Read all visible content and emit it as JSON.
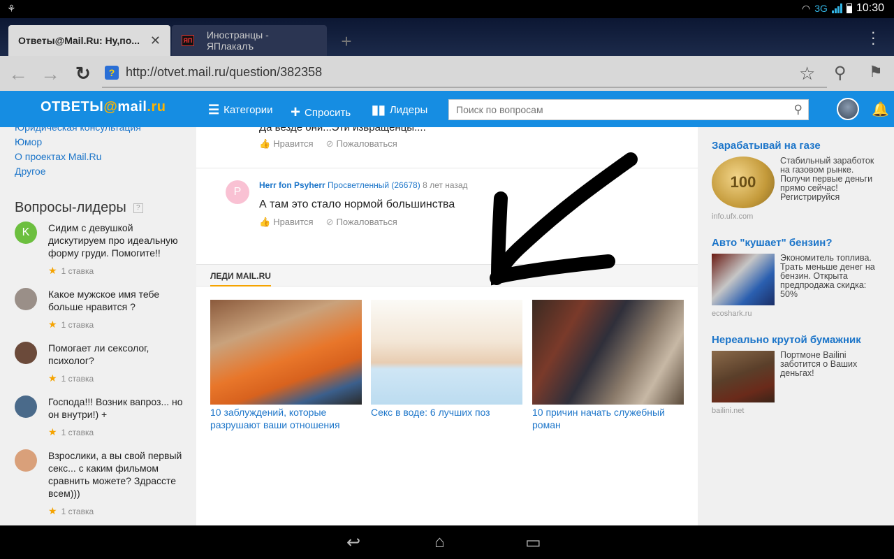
{
  "status_bar": {
    "network": "3G",
    "time": "10:30"
  },
  "tabs": [
    {
      "title": "Ответы@Mail.Ru: Ну,по...",
      "active": true,
      "close": "✕"
    },
    {
      "title": "Иностранцы - ЯПлакалъ",
      "active": false,
      "favicon_text": "ЯП"
    }
  ],
  "new_tab": "+",
  "address_bar": {
    "url": "http://otvet.mail.ru/question/382358"
  },
  "site_header": {
    "logo_prefix": "ОТВЕТЫ",
    "logo_at": "@",
    "logo_mail": "mail",
    "logo_ru": ".ru",
    "nav": [
      {
        "label": "Категории",
        "icon": "list-icon"
      },
      {
        "label": "Спросить",
        "icon": "plus-icon"
      },
      {
        "label": "Лидеры",
        "icon": "bar-chart-icon"
      }
    ],
    "search_placeholder": "Поиск по вопросам"
  },
  "left_sidebar": {
    "links": [
      "Юридическая консультация",
      "Юмор",
      "О проектах Mail.Ru",
      "Другое"
    ],
    "leaders_title": "Вопросы-лидеры",
    "leaders_help": "?",
    "questions": [
      {
        "avatar_letter": "K",
        "avatar_color": "#6cbf3f",
        "text": "Сидим с девушкой дискутируем про идеальную форму груди. Помогите!!",
        "bets": "1 ставка"
      },
      {
        "avatar_letter": "",
        "avatar_color": "#9a8f88",
        "text": "Какое мужское имя тебе больше нравится ?",
        "bets": "1 ставка"
      },
      {
        "avatar_letter": "",
        "avatar_color": "#6b4a3a",
        "text": "Помогает ли сексолог, психолог?",
        "bets": "1 ставка"
      },
      {
        "avatar_letter": "",
        "avatar_color": "#4a6a8a",
        "text": "Господа!!! Возник вапроз... но он внутри!) +",
        "bets": "1 ставка"
      },
      {
        "avatar_letter": "",
        "avatar_color": "#d9a07a",
        "text": "Взрослики, а вы свой первый секс... с каким фильмом сравнить можете? Здрассте всем)))",
        "bets": "1 ставка"
      }
    ]
  },
  "main": {
    "prev_answer_text": "Да везде они...Эти извращенцы....",
    "like_label": "Нравится",
    "report_label": "Пожаловаться",
    "answer": {
      "avatar_letter": "P",
      "author": "Herr fon Psyherr",
      "rank": "Просветленный (26678)",
      "time": "8 лет назад",
      "text": "А там это стало нормой большинства"
    },
    "ladies_label": "ЛЕДИ MAIL.RU",
    "cards": [
      {
        "caption": "10 заблуждений, которые разрушают ваши отношения"
      },
      {
        "caption": "Секс в воде: 6 лучших поз"
      },
      {
        "caption": "10 причин начать служебный роман"
      }
    ]
  },
  "right_sidebar": {
    "ads": [
      {
        "title": "Зарабатывай на газе",
        "desc": "Стабильный заработок на газовом рынке. Получи первые деньги прямо сейчас! Регистрируйся",
        "source": "info.ufx.com",
        "image_text": "100"
      },
      {
        "title": "Авто \"кушает\" бензин?",
        "desc": "Экономитель топлива. Трать меньше денег на бензин. Открыта предпродажа скидка: 50%",
        "source": "ecoshark.ru"
      },
      {
        "title": "Нереально крутой бумажник",
        "desc": "Портмоне Bailini заботится о Ваших деньгах!",
        "source": "bailini.net"
      }
    ]
  }
}
